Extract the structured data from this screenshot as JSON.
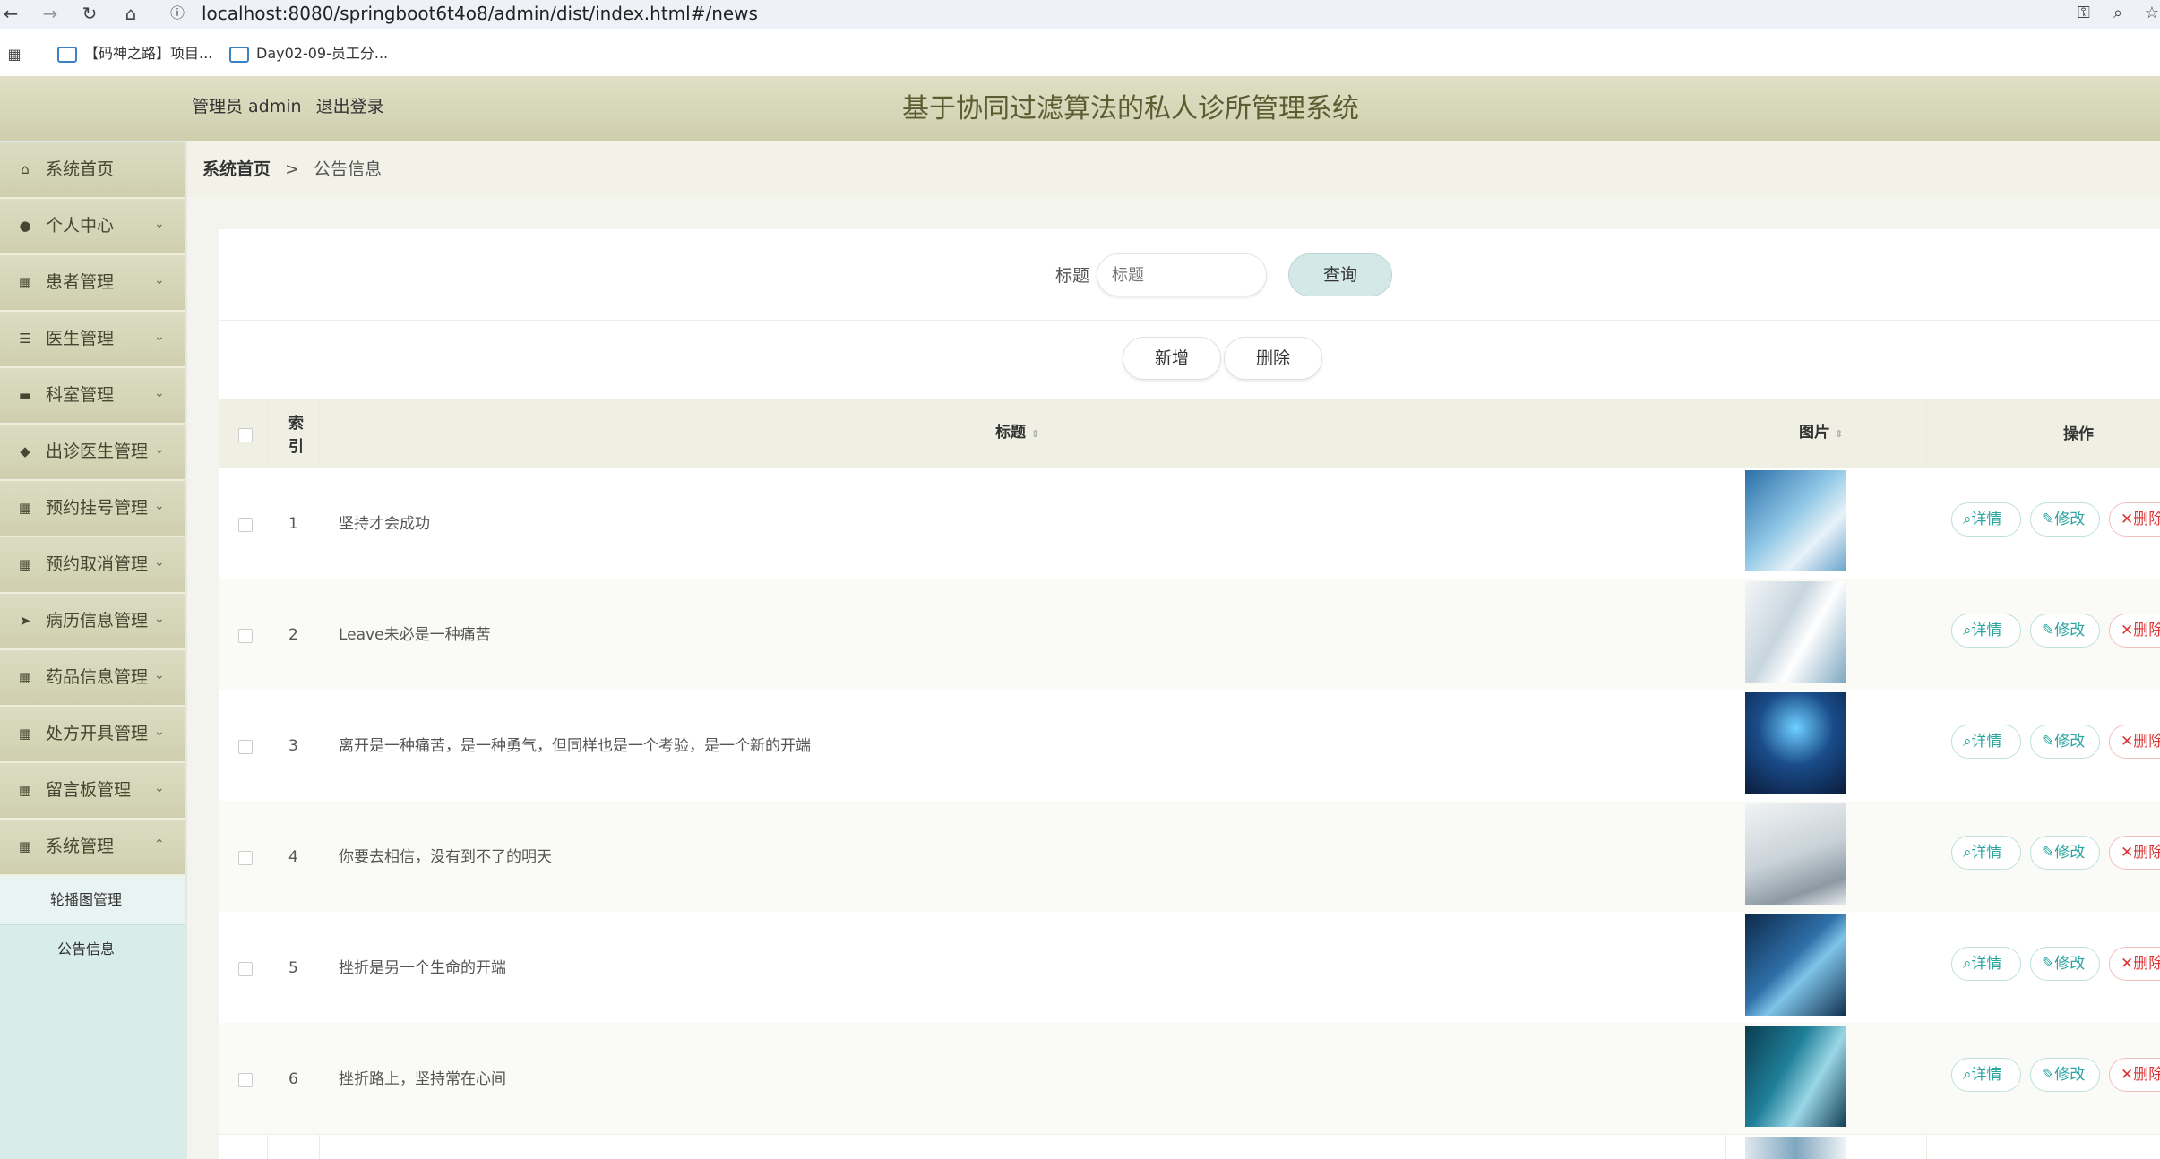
{
  "browser": {
    "url": "localhost:8080/springboot6t4o8/admin/dist/index.html#/news",
    "bookmarks": [
      "【码神之路】项目...",
      "Day02-09-员工分..."
    ]
  },
  "header": {
    "user_label": "管理员 admin",
    "logout": "退出登录",
    "title": "基于协同过滤算法的私人诊所管理系统"
  },
  "sidebar": {
    "items": [
      {
        "label": "系统首页",
        "icon": "home-icon"
      },
      {
        "label": "个人中心",
        "icon": "user-icon"
      },
      {
        "label": "患者管理",
        "icon": "grid-icon"
      },
      {
        "label": "医生管理",
        "icon": "sliders-icon"
      },
      {
        "label": "科室管理",
        "icon": "monitor-icon"
      },
      {
        "label": "出诊医生管理",
        "icon": "location-icon"
      },
      {
        "label": "预约挂号管理",
        "icon": "grid-icon"
      },
      {
        "label": "预约取消管理",
        "icon": "grid-icon"
      },
      {
        "label": "病历信息管理",
        "icon": "send-icon"
      },
      {
        "label": "药品信息管理",
        "icon": "grid-icon"
      },
      {
        "label": "处方开具管理",
        "icon": "grid-icon"
      },
      {
        "label": "留言板管理",
        "icon": "grid-icon"
      },
      {
        "label": "系统管理",
        "icon": "grid-icon"
      }
    ],
    "subitems": [
      "轮播图管理",
      "公告信息"
    ]
  },
  "breadcrumb": {
    "home": "系统首页",
    "separator": ">",
    "current": "公告信息"
  },
  "search": {
    "label": "标题",
    "placeholder": "标题",
    "button": "查询"
  },
  "toolbar": {
    "add": "新增",
    "delete": "删除"
  },
  "table": {
    "headers": {
      "index": "索引",
      "title": "标题",
      "image": "图片",
      "actions": "操作"
    },
    "action_labels": {
      "detail": "详情",
      "edit": "修改",
      "delete": "删除"
    },
    "rows": [
      {
        "index": "1",
        "title": "坚持才会成功"
      },
      {
        "index": "2",
        "title": "Leave未必是一种痛苦"
      },
      {
        "index": "3",
        "title": "离开是一种痛苦，是一种勇气，但同样也是一个考验，是一个新的开端"
      },
      {
        "index": "4",
        "title": "你要去相信，没有到不了的明天"
      },
      {
        "index": "5",
        "title": "挫折是另一个生命的开端"
      },
      {
        "index": "6",
        "title": "挫折路上，坚持常在心间"
      }
    ]
  },
  "colors": {
    "accent": "#2aa5a0",
    "header": "#cfcfae",
    "sidebar": "#d8ecea",
    "danger": "#dd3333"
  }
}
